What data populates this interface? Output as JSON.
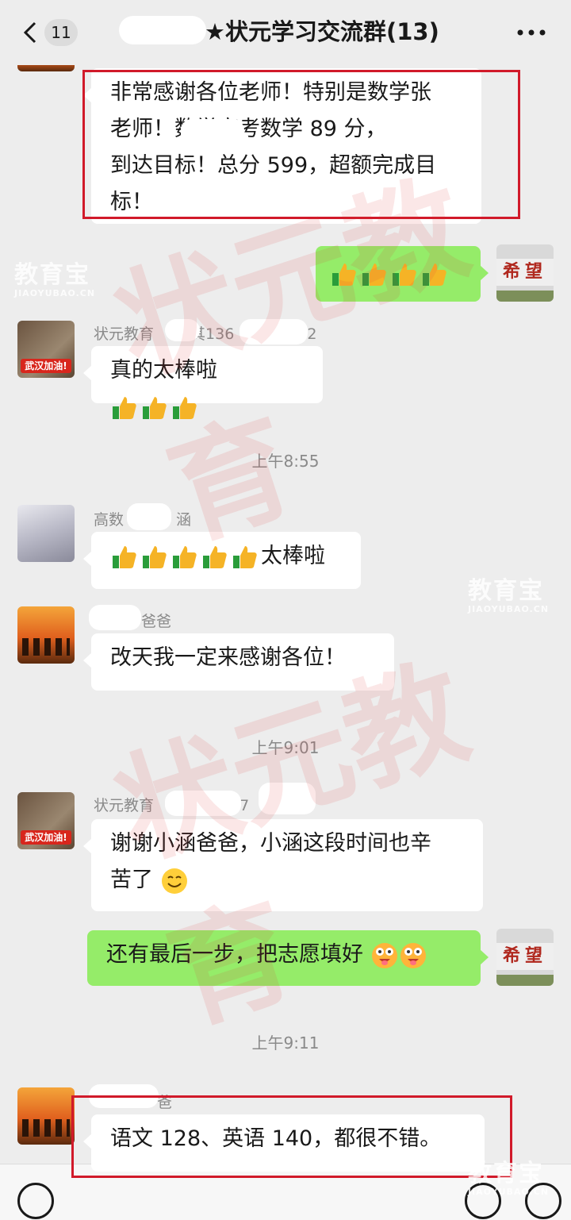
{
  "header": {
    "back_badge": "11",
    "title": "★状元学习交流群(13)"
  },
  "watermarks": {
    "logo_big": "教育宝",
    "logo_small": "JIAOYUBAO.CN",
    "stamp_text": "状元教育"
  },
  "avatars": {
    "edu_tag": "武汉加油!",
    "hope_sign": "希望"
  },
  "messages": [
    {
      "type": "bubble",
      "side": "left",
      "text_lines": [
        "非常感谢各位老师！特别是数学张",
        "老师！数学高考数学 89 分，",
        "到达目标！总分 599，超额完成目",
        "标！"
      ]
    },
    {
      "type": "bubble",
      "side": "right",
      "emoji": "thumbs-up x4"
    },
    {
      "type": "bubble",
      "side": "left",
      "sender": "状元教育",
      "sender_suffix": "其136",
      "sender_tail": "72",
      "text": "真的太棒啦"
    },
    {
      "type": "time",
      "text": "上午8:55"
    },
    {
      "type": "bubble",
      "side": "left",
      "sender": "高数",
      "sender_tail": "涵",
      "text": "太棒啦"
    },
    {
      "type": "bubble",
      "side": "left",
      "sender_tail": "爸爸",
      "text": "改天我一定来感谢各位！"
    },
    {
      "type": "time",
      "text": "上午9:01"
    },
    {
      "type": "bubble",
      "side": "left",
      "sender": "状元教育",
      "sender_suffix": "27",
      "sender_tail": "2",
      "text_lines": [
        "谢谢小涵爸爸，小涵这段时间也辛",
        "苦了"
      ]
    },
    {
      "type": "bubble",
      "side": "right",
      "text": "还有最后一步，把志愿填好"
    },
    {
      "type": "time",
      "text": "上午9:11"
    },
    {
      "type": "bubble",
      "side": "left",
      "sender_tail": "爸",
      "text": "语文 128、英语 140，都很不错。"
    }
  ],
  "colors": {
    "bg": "#ededed",
    "bubble_white": "#ffffff",
    "bubble_green": "#95ec69",
    "highlight": "#d11a2a"
  }
}
